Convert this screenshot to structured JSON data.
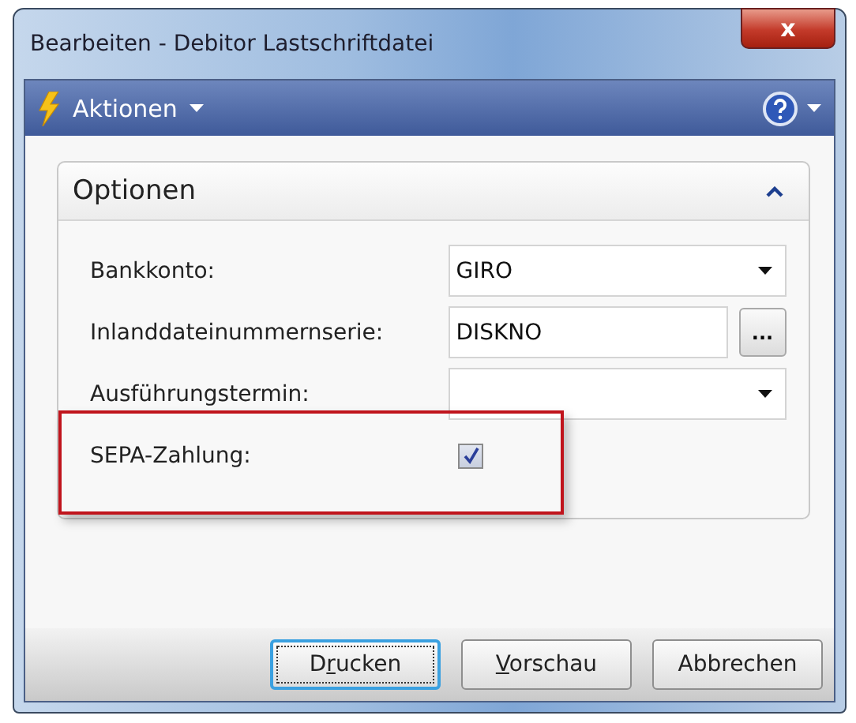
{
  "window": {
    "title": "Bearbeiten - Debitor Lastschriftdatei",
    "close": "x"
  },
  "toolbar": {
    "actions_label": "Aktionen"
  },
  "section": {
    "title": "Optionen",
    "expanded": true
  },
  "fields": [
    {
      "kind": "dropdown",
      "label": "Bankkonto:",
      "value": "GIRO",
      "highlighted": false
    },
    {
      "kind": "lookup",
      "label": "Inlanddateinummernserie:",
      "value": "DISKNO",
      "button": "...",
      "highlighted": false
    },
    {
      "kind": "dropdown",
      "label": "Ausführungstermin:",
      "highlighted": false
    },
    {
      "kind": "checkbox",
      "label": "SEPA-Zahlung:",
      "checked": true,
      "highlighted": true
    }
  ],
  "buttons": [
    {
      "label_before_key": "D",
      "access_key": "r",
      "label_after_key": "ucken",
      "focused": true
    },
    {
      "access_key": "V",
      "label_after_key": "orschau",
      "focused": false
    },
    {
      "label_before_key": "Abbrechen",
      "focused": false
    }
  ]
}
